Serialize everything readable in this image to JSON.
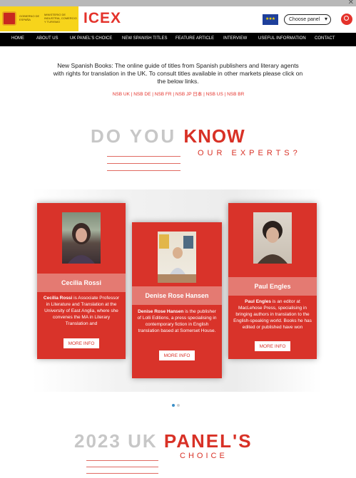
{
  "window": {
    "close_glyph": "✕"
  },
  "header": {
    "gov_name": "GOBIERNO DE ESPAÑA",
    "ministry": "MINISTERIO DE INDUSTRIA, COMERCIO Y TURISMO",
    "brand": "ICEX",
    "flag_stars": "★★★",
    "language_select": {
      "selected": "Choose panel",
      "chevron": "▾"
    }
  },
  "nav": {
    "items": [
      "HOME",
      "ABOUT US",
      "UK PANEL'S CHOICE",
      "NEW SPANISH TITLES",
      "FEATURE ARTICLE",
      "INTERVIEW",
      "USEFUL INFORMATION",
      "CONTACT"
    ]
  },
  "intro": {
    "text": "New Spanish Books: The online guide of titles from Spanish publishers and literary agents with rights for translation in the UK. To consult titles available in other markets please click on the below links.",
    "links_line": "NSB UK | NSB DE | NSB FR | NSB JP 日本 | NSB US | NSB BR"
  },
  "experts_section": {
    "heading_grey": "DO YOU ",
    "heading_red": "KNOW",
    "subheading": "OUR EXPERTS?"
  },
  "cards": [
    {
      "name": "Cecilia Rossi",
      "bio_bold": "Cecilia Rossi",
      "bio": " is Associate Professor in Literature and Translation at the University of East Anglia, where she convenes the MA in Literary Translation and",
      "button": "MORE INFO"
    },
    {
      "name": "Denise Rose Hansen",
      "bio_bold": "Denise Rose Hansen",
      "bio": " is the publisher of Lolli Editions, a press specialising in contemporary fiction in English translation based at Somerset House.",
      "button": "MORE INFO"
    },
    {
      "name": "Paul Engles",
      "bio_bold": "Paul Engles",
      "bio": " is an editor at MacLehose Press, specialising in bringing authors in translation to the English-speaking world. Books he has edited or published have won",
      "button": "MORE INFO"
    }
  ],
  "carousel": {
    "active_index": 0,
    "count": 2
  },
  "panel_section": {
    "heading_grey": "2023 UK ",
    "heading_red": "PANEL'S",
    "subheading": "CHOICE"
  },
  "colors": {
    "brand_red": "#d83126",
    "nav_bg": "#000000",
    "gov_yellow": "#f7d41b",
    "heading_grey": "#c7c7c7"
  }
}
